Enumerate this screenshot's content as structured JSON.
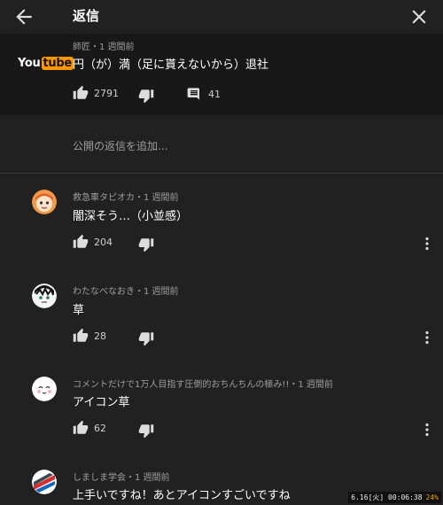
{
  "header": {
    "title": "返信"
  },
  "parent": {
    "channel_logo": {
      "you": "You",
      "tube": "tube"
    },
    "meta": "師匠・1 週間前",
    "text": "円（が）満（足に貰えないから）退社",
    "likes": "2791",
    "replies": "41"
  },
  "add_reply": {
    "placeholder": "公開の返信を追加..."
  },
  "replies": [
    {
      "meta": "救急車タピオカ・1 週間前",
      "text": "闇深そう…（小並感）",
      "likes": "204"
    },
    {
      "meta": "わたなべなおき・1 週間前",
      "text": "草",
      "likes": "28"
    },
    {
      "meta": "コメントだけで1万人目指す圧倒的おちんちんの極み!!・1 週間前",
      "text": "アイコン草",
      "likes": "62"
    },
    {
      "meta": "しましま学会・1 週間前",
      "text": "上手いですね！あとアイコンすごいですね",
      "likes": ""
    }
  ],
  "status_bar": {
    "text": "6.16[火] 00:06:38",
    "battery": "24%"
  },
  "icons": {
    "back": "arrow-left-icon",
    "close": "close-icon",
    "like": "thumbs-up-icon",
    "dislike": "thumbs-down-icon",
    "reply": "comment-icon",
    "more": "more-vert-icon"
  },
  "colors": {
    "background": "#212121",
    "parent_background": "#181818",
    "accent_logo": "#ff9800"
  }
}
